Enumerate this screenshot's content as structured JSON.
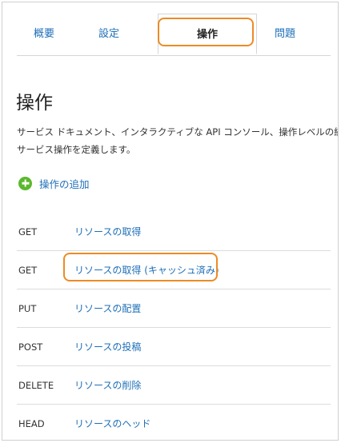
{
  "tabs": [
    {
      "label": "概要"
    },
    {
      "label": "設定"
    },
    {
      "label": "操作"
    },
    {
      "label": "問題"
    }
  ],
  "page": {
    "title": "操作",
    "description_line1": "サービス ドキュメント、インタラクティブな API コンソール、操作レベルの統計を有効にす",
    "description_line2": "サービス操作を定義します。"
  },
  "add_operation": {
    "label": "操作の追加",
    "icon": "plus-circle-icon"
  },
  "operations": [
    {
      "method": "GET",
      "name": "リソースの取得"
    },
    {
      "method": "GET",
      "name": "リソースの取得 (キャッシュ済み)"
    },
    {
      "method": "PUT",
      "name": "リソースの配置"
    },
    {
      "method": "POST",
      "name": "リソースの投稿"
    },
    {
      "method": "DELETE",
      "name": "リソースの削除"
    },
    {
      "method": "HEAD",
      "name": "リソースのヘッド"
    }
  ],
  "colors": {
    "link": "#1e6fb8",
    "highlight": "#ec8b25",
    "add_icon": "#5bb82d"
  }
}
